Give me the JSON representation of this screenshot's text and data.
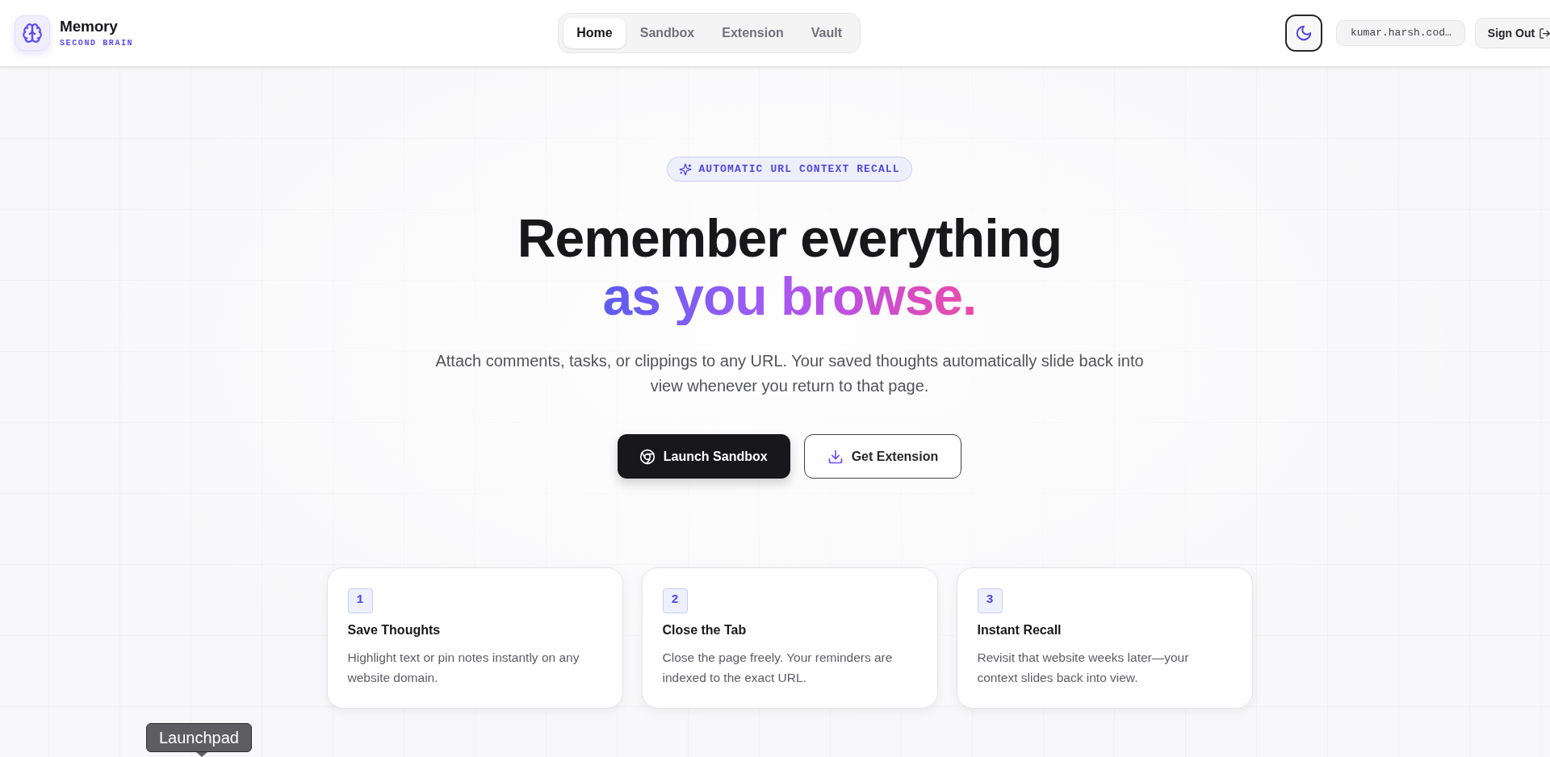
{
  "brand": {
    "name": "Memory",
    "tagline": "SECOND BRAIN"
  },
  "nav_tabs": [
    {
      "label": "Home",
      "selected": true
    },
    {
      "label": "Sandbox",
      "selected": false
    },
    {
      "label": "Extension",
      "selected": false
    },
    {
      "label": "Vault",
      "selected": false
    }
  ],
  "account": {
    "email": "kumar.harsh.cod…",
    "sign_out": "Sign Out"
  },
  "hero": {
    "badge": "AUTOMATIC URL CONTEXT RECALL",
    "title": "Remember everything",
    "title_highlight": "as you browse.",
    "description": "Attach comments, tasks, or clippings to any URL. Your saved thoughts automatically slide back into view whenever you return to that page.",
    "buttons": [
      {
        "label": "Launch Sandbox",
        "kind": "primary"
      },
      {
        "label": "Get Extension",
        "kind": "outline"
      }
    ]
  },
  "steps": [
    {
      "number": "1",
      "title": "Save Thoughts",
      "description": "Highlight text or pin notes instantly on any website domain."
    },
    {
      "number": "2",
      "title": "Close the Tab",
      "description": "Close the page freely. Your reminders are indexed to the exact URL."
    },
    {
      "number": "3",
      "title": "Instant Recall",
      "description": "Revisit that website weeks later—your context slides back into view."
    }
  ],
  "tooltip": {
    "label": "Launchpad"
  }
}
